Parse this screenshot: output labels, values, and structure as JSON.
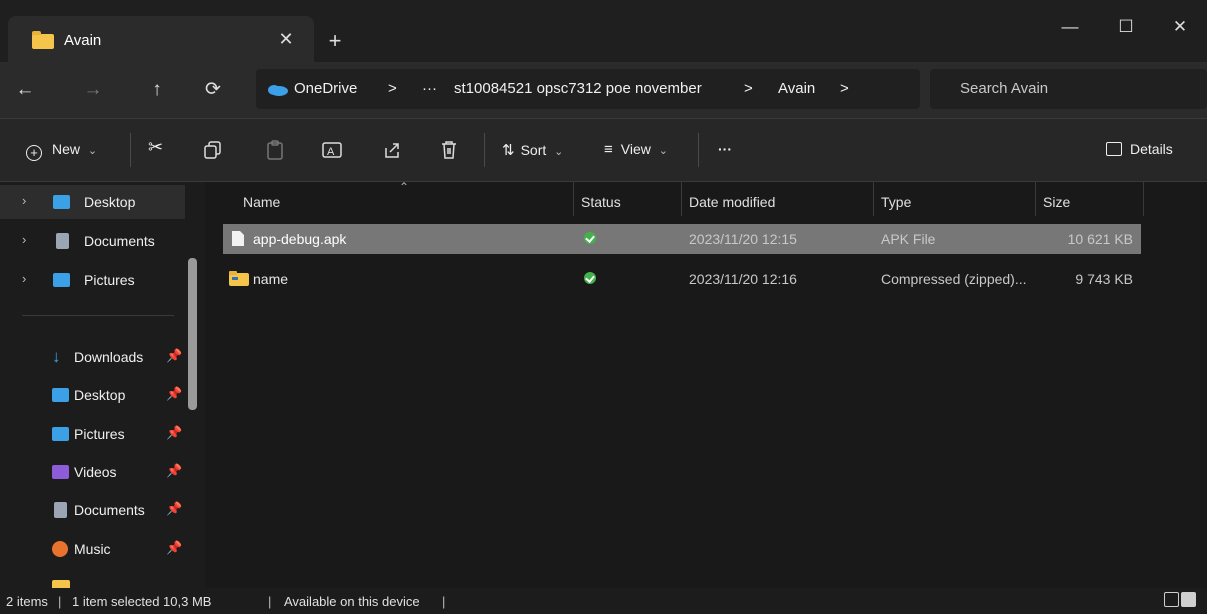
{
  "window": {
    "tab_title": "Avain",
    "tab_close": "✕",
    "new_tab": "+",
    "minimize": "—",
    "maximize": "☐",
    "close": "✕"
  },
  "nav": {
    "back": "←",
    "forward": "→",
    "up": "↑",
    "refresh": "⟳",
    "breadcrumb": [
      "OneDrive",
      ">",
      "···",
      "st10084521 opsc7312 poe november",
      ">",
      "Avain",
      ">"
    ],
    "search_placeholder": "Search Avain"
  },
  "toolbar": {
    "new_label": "New",
    "sort_label": "Sort",
    "view_label": "View",
    "more_label": "···",
    "details_label": "Details",
    "chevron": "⌄"
  },
  "sidebar": {
    "top_items": [
      {
        "label": "Desktop",
        "icon": "desktop-icon",
        "color": "#3ca0e6"
      },
      {
        "label": "Documents",
        "icon": "documents-icon",
        "color": "#9aa6b4"
      },
      {
        "label": "Pictures",
        "icon": "pictures-icon",
        "color": "#3ca0e6"
      }
    ],
    "pinned_items": [
      {
        "label": "Downloads",
        "icon": "downloads-icon"
      },
      {
        "label": "Desktop",
        "icon": "desktop-icon"
      },
      {
        "label": "Pictures",
        "icon": "pictures-icon"
      },
      {
        "label": "Videos",
        "icon": "videos-icon"
      },
      {
        "label": "Documents",
        "icon": "documents-icon"
      },
      {
        "label": "Music",
        "icon": "music-icon"
      }
    ]
  },
  "columns": [
    "Name",
    "Status",
    "Date modified",
    "Type",
    "Size"
  ],
  "files": [
    {
      "name": "app-debug.apk",
      "date": "2023/11/20 12:15",
      "type": "APK File",
      "size": "10 621 KB",
      "selected": true
    },
    {
      "name": "name",
      "date": "2023/11/20 12:16",
      "type": "Compressed (zipped)...",
      "size": "9 743 KB",
      "selected": false
    }
  ],
  "status": {
    "items": "2 items",
    "selected": "1 item selected  10,3 MB",
    "availability": "Available on this device"
  },
  "colors": {
    "selection": "#777777",
    "accent_folder": "#f4c44b",
    "sync_ok": "#44b24c"
  }
}
